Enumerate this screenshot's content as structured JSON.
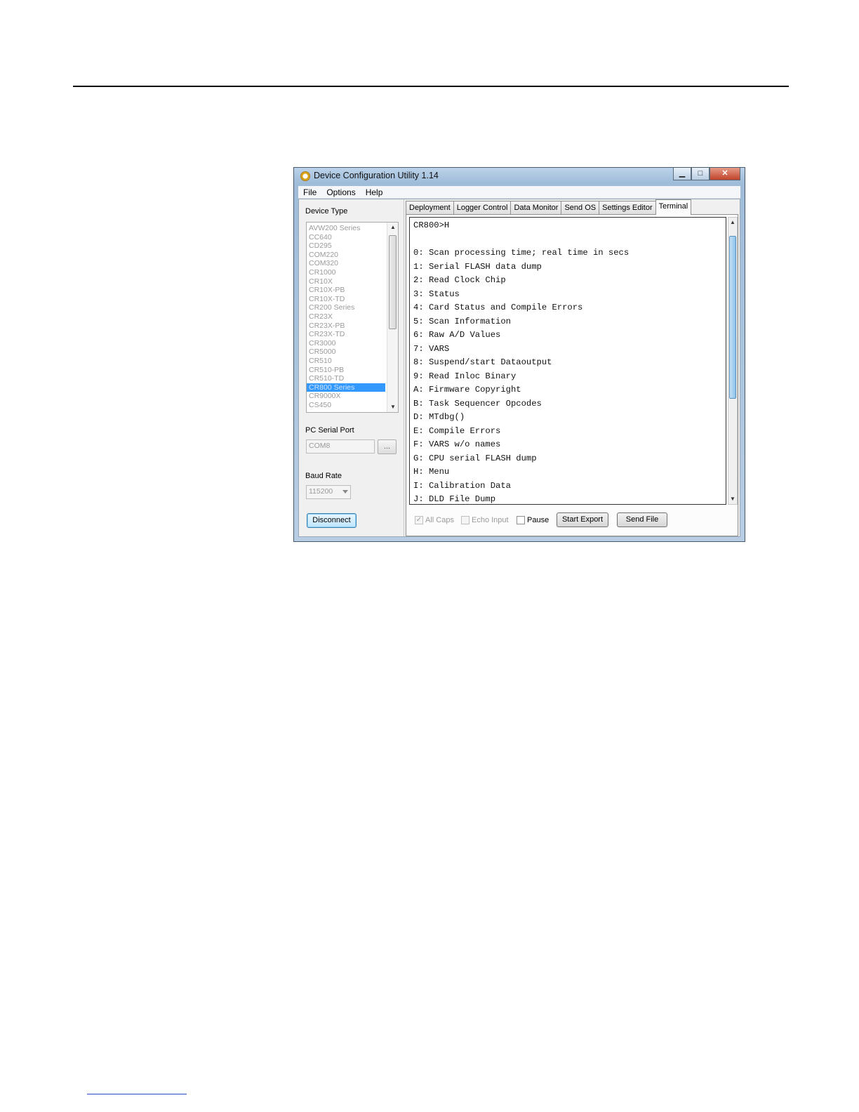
{
  "window": {
    "title": "Device Configuration Utility 1.14",
    "controls": {
      "minimize": "▁",
      "maximize": "□",
      "close": "✕"
    }
  },
  "menu": [
    "File",
    "Options",
    "Help"
  ],
  "left": {
    "device_type_label": "Device Type",
    "device_list": [
      "AVW200 Series",
      "CC640",
      "CD295",
      "COM220",
      "COM320",
      "CR1000",
      "CR10X",
      "CR10X-PB",
      "CR10X-TD",
      "CR200 Series",
      "CR23X",
      "CR23X-PB",
      "CR23X-TD",
      "CR3000",
      "CR5000",
      "CR510",
      "CR510-PB",
      "CR510-TD",
      "CR800 Series",
      "CR9000X",
      "CS450"
    ],
    "selected_device": "CR800 Series",
    "pc_serial_port_label": "PC Serial Port",
    "serial_port_value": "COM8",
    "browse_label": "...",
    "baud_rate_label": "Baud Rate",
    "baud_rate_value": "115200",
    "disconnect_label": "Disconnect"
  },
  "tabs": [
    "Deployment",
    "Logger Control",
    "Data Monitor",
    "Send OS",
    "Settings Editor",
    "Terminal"
  ],
  "active_tab": "Terminal",
  "terminal": {
    "lines": [
      "CR800>H",
      "",
      "0: Scan processing time; real time in secs",
      "1: Serial FLASH data dump",
      "2: Read Clock Chip",
      "3: Status",
      "4: Card Status and Compile Errors",
      "5: Scan Information",
      "6: Raw A/D Values",
      "7: VARS",
      "8: Suspend/start Dataoutput",
      "9: Read Inloc Binary",
      "A: Firmware Copyright",
      "B: Task Sequencer Opcodes",
      "D: MTdbg()",
      "E: Compile Errors",
      "F: VARS w/o names",
      "G: CPU serial FLASH dump",
      "H: Menu",
      "I: Calibration Data",
      "J: DLD File Dump"
    ]
  },
  "bottom": {
    "all_caps_label": "All Caps",
    "all_caps_checked": true,
    "echo_input_label": "Echo Input",
    "echo_input_checked": false,
    "pause_label": "Pause",
    "pause_checked": false,
    "start_export_label": "Start Export",
    "send_file_label": "Send File"
  },
  "colors": {
    "selection": "#3399ff",
    "link_underline": "#2a49c8"
  }
}
